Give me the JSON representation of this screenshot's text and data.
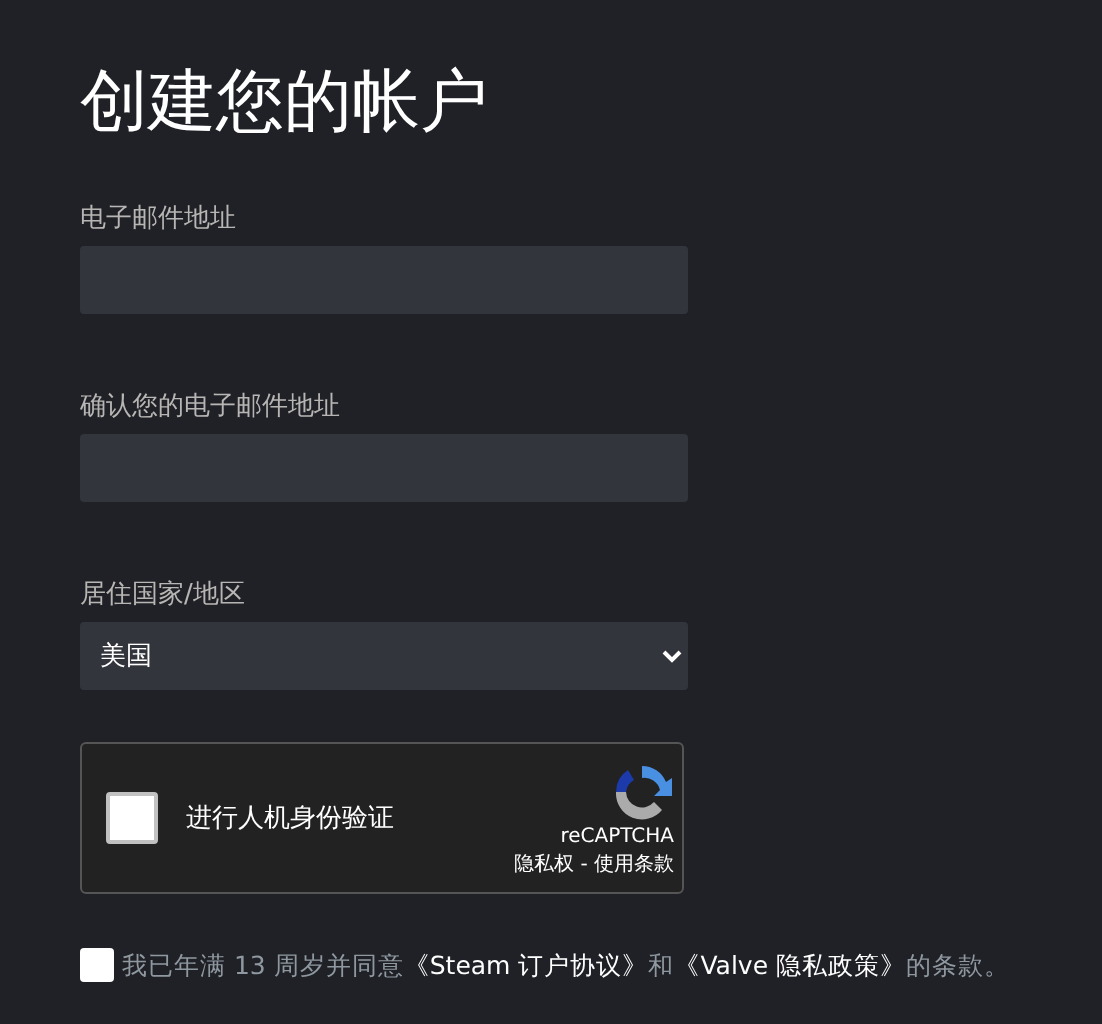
{
  "title": "创建您的帐户",
  "fields": [
    {
      "kind": "input",
      "label": "电子邮件地址"
    },
    {
      "kind": "input",
      "label": "确认您的电子邮件地址"
    },
    {
      "kind": "select",
      "label": "居住国家/地区",
      "value": "美国"
    }
  ],
  "captcha": {
    "checked": false,
    "label": "进行人机身份验证",
    "brand": "reCAPTCHA",
    "terms": "隐私权 - 使用条款"
  },
  "agreement": {
    "checked": false,
    "parts": [
      {
        "kind": "text",
        "text": "我已年满 13 周岁并同意"
      },
      {
        "kind": "link",
        "text": "《Steam 订户协议》"
      },
      {
        "kind": "text",
        "text": "和"
      },
      {
        "kind": "link",
        "text": "《Valve 隐私政策》"
      },
      {
        "kind": "text",
        "text": "的条款。"
      }
    ]
  }
}
